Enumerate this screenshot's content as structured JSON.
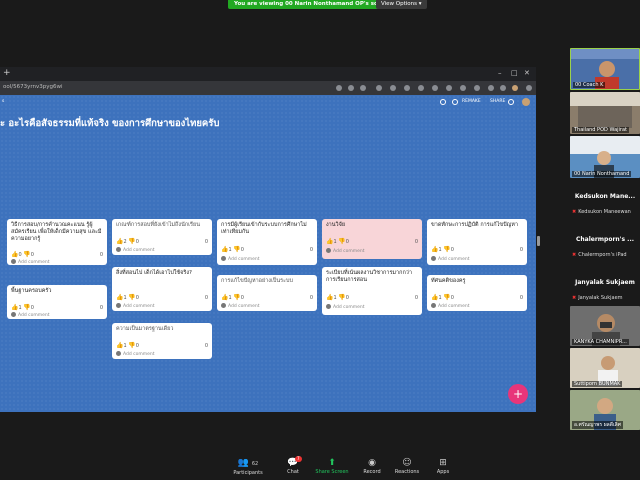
{
  "zoom_banner": {
    "viewing_text": "You are viewing 00 Narin Nonthamand OP's screen",
    "view_options": "View Options ▾"
  },
  "browser": {
    "url": "ool/5673yrnv3pyg6wi",
    "plus": "+",
    "win_min": "–",
    "win_max": "□",
    "win_close": "✕"
  },
  "board": {
    "title": "ะ อะไรคือสัจธรรมที่แท้จริง ของการศึกษาของไทยครับ",
    "top_left": "s",
    "remake": "REMAKE",
    "share": "SHARE"
  },
  "columns": [
    {
      "cards": [
        {
          "text": "วิธีการสอบ/การคำนวณคะแนน รู้ผู้สมัครเรียน เพื่อให้เด็กมีความสุข และมีความอยากรู้",
          "likes": "0",
          "dislikes": "0",
          "comments": "0",
          "add": "Add comment"
        },
        {
          "text": "พื้นฐานครอบครัว",
          "likes": "1",
          "dislikes": "0",
          "comments": "0",
          "add": "Add comment"
        }
      ]
    },
    {
      "cards": [
        {
          "text": "เกณฑ์การสอบที่ยังเข้าไม่ถึงนักเรียน",
          "likes": "2",
          "dislikes": "0",
          "comments": "0",
          "add": "Add comment"
        },
        {
          "text": "สิ่งที่สอนไป เด็กได้เอาไปใช้จริง?",
          "likes": "1",
          "dislikes": "0",
          "comments": "0",
          "add": "Add comment"
        },
        {
          "text": "ความเป็นมาตรฐานเดียว",
          "likes": "1",
          "dislikes": "0",
          "comments": "0",
          "add": "Add comment"
        }
      ]
    },
    {
      "cards": [
        {
          "text": "การมีผู้เรียนเข้ากับระบบการศึกษาไม่เท่าเทียมกัน",
          "likes": "1",
          "dislikes": "0",
          "comments": "0",
          "add": "Add comment"
        },
        {
          "text": "การแก้ไขปัญหาอย่างเป็นระบบ",
          "likes": "1",
          "dislikes": "0",
          "comments": "0",
          "add": "Add comment"
        }
      ]
    },
    {
      "cards": [
        {
          "text": "งานวิจัย",
          "likes": "1",
          "dislikes": "0",
          "comments": "0",
          "add": "Add comment",
          "pink": true
        },
        {
          "text": "ระเบียบที่เน้นผลงานวิชาการมากกว่าการเรียนการสอน",
          "likes": "1",
          "dislikes": "0",
          "comments": "0",
          "add": "Add comment"
        }
      ]
    },
    {
      "cards": [
        {
          "text": "ขาดทักษะการปฏิบัติ การแก้ไขปัญหา",
          "likes": "1",
          "dislikes": "0",
          "comments": "0",
          "add": "Add comment"
        },
        {
          "text": "ทัศนคติของครู",
          "likes": "1",
          "dislikes": "0",
          "comments": "0",
          "add": "Add comment"
        }
      ]
    }
  ],
  "fab": "+",
  "participants": [
    {
      "name": "00 Coach K",
      "kind": "video",
      "bg": "#4a6fa8"
    },
    {
      "name": "Thailand POD Wajirat",
      "kind": "video",
      "bg": "#8b7d6b"
    },
    {
      "name": "00 Narin Nonthamand",
      "kind": "video",
      "bg": "#5b8fc2"
    },
    {
      "title": "Kedsukon Mane...",
      "sub": "Kedsukon Maneewan",
      "kind": "name"
    },
    {
      "title": "Chalermporn's ...",
      "sub": "Chalermporn's iPad",
      "kind": "name"
    },
    {
      "title": "Janyalak Sukjaem",
      "sub": "Janyalak Sukjaem",
      "kind": "name"
    },
    {
      "name": "KANYKA CHAMNIPR...",
      "kind": "video",
      "bg": "#6e6e6e"
    },
    {
      "name": "Suttiporn BUNMAK",
      "kind": "video",
      "bg": "#a09880"
    },
    {
      "name": "อ.ศรัณญาพร ผลดีเลิศ",
      "kind": "video",
      "bg": "#7a8a70"
    }
  ],
  "toolbar": {
    "participants_label": "Participants",
    "participants_count": "62",
    "chat_label": "Chat",
    "chat_badge": "7",
    "share_label": "Share Screen",
    "record_label": "Record",
    "reactions_label": "Reactions",
    "apps_label": "Apps"
  },
  "colors": {
    "accent_green": "#22a822",
    "board_blue": "#3d72bd",
    "fab_pink": "#e8357a",
    "heart_purple": "#6a4dc6"
  }
}
